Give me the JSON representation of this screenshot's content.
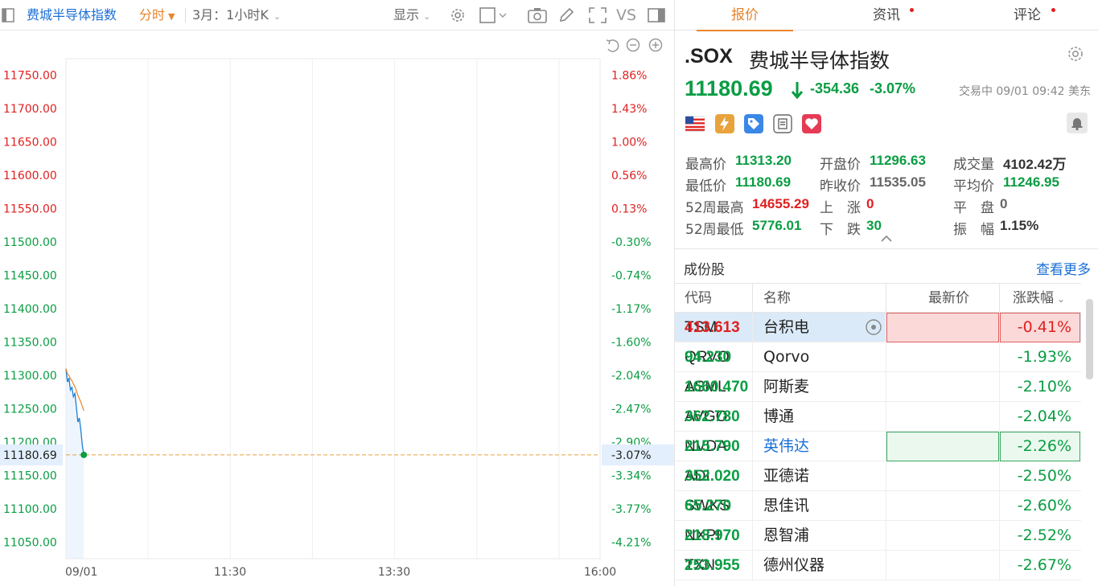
{
  "toolbar": {
    "index_name": "费城半导体指数",
    "chart_mode": "分时",
    "period": "3月：1小时K",
    "display": "显示",
    "vs": "VS"
  },
  "chart": {
    "left_axis": [
      "11750.00",
      "11700.00",
      "11650.00",
      "11600.00",
      "11550.00",
      "11500.00",
      "11450.00",
      "11400.00",
      "11350.00",
      "11300.00",
      "11250.00",
      "11200.00",
      "11150.00",
      "11100.00",
      "11050.00"
    ],
    "right_axis": [
      "1.86%",
      "1.43%",
      "1.00%",
      "0.56%",
      "0.13%",
      "-0.30%",
      "-0.74%",
      "-1.17%",
      "-1.60%",
      "-2.04%",
      "-2.47%",
      "-2.90%",
      "-3.34%",
      "-3.77%",
      "-4.21%"
    ],
    "x_labels": [
      "09/01",
      "11:30",
      "13:30",
      "16:00"
    ],
    "current_price_label": "11180.69",
    "current_pct_label": "-3.07%",
    "colors": {
      "line": "#1a7fd6",
      "avg": "#e8842c",
      "up": "#e02020",
      "down": "#0a9d43"
    }
  },
  "chart_data": {
    "type": "line",
    "x": [
      "09:30",
      "09:31",
      "09:32",
      "09:33",
      "09:34",
      "09:35",
      "09:36",
      "09:37",
      "09:38",
      "09:39",
      "09:40",
      "09:41",
      "09:42"
    ],
    "series": [
      {
        "values": [
          11310,
          11290,
          11296,
          11278,
          11282,
          11268,
          11273,
          11252,
          11230,
          11236,
          11218,
          11195,
          11180.69
        ]
      },
      {
        "values": [
          11310,
          11302,
          11300,
          11295,
          11292,
          11287,
          11283,
          11277,
          11270,
          11265,
          11260,
          11253,
          11246.95
        ]
      }
    ],
    "ylim": [
      11025,
      11775
    ],
    "xlabels": [
      "09/01",
      "11:30",
      "13:30",
      "16:00"
    ]
  },
  "tabs": [
    {
      "label": "报价"
    },
    {
      "label": "资讯"
    },
    {
      "label": "评论"
    }
  ],
  "quote": {
    "symbol": ".SOX",
    "name": "费城半导体指数",
    "price": "11180.69",
    "change": "-354.36",
    "change_pct": "-3.07%",
    "status": "交易中 09/01 09:42 美东"
  },
  "stats": {
    "high_label": "最高价",
    "high": "11313.20",
    "open_label": "开盘价",
    "open": "11296.63",
    "volume_label": "成交量",
    "volume": "4102.42万",
    "low_label": "最低价",
    "low": "11180.69",
    "prev_label": "昨收价",
    "prev": "11535.05",
    "avg_label": "平均价",
    "avg": "11246.95",
    "wk52_high_label": "52周最高",
    "wk52_high": "14655.29",
    "up_label": "上　涨",
    "up": "0",
    "flat_label": "平　盘",
    "flat": "0",
    "wk52_low_label": "52周最低",
    "wk52_low": "5776.01",
    "down_label": "下　跌",
    "down": "30",
    "amp_label": "振　幅",
    "amp": "1.15%"
  },
  "constituents": {
    "title": "成份股",
    "more": "查看更多",
    "headers": {
      "code": "代码",
      "name": "名称",
      "price": "最新价",
      "pct": "涨跌幅"
    },
    "rows": [
      {
        "code": "TSM",
        "name": "台积电",
        "price": "413.613",
        "pct": "-0.41%"
      },
      {
        "code": "QRVO",
        "name": "Qorvo",
        "price": "94.230",
        "pct": "-1.93%"
      },
      {
        "code": "ASML",
        "name": "阿斯麦",
        "price": "1660.470",
        "pct": "-2.10%"
      },
      {
        "code": "AVGO",
        "name": "博通",
        "price": "362.780",
        "pct": "-2.04%"
      },
      {
        "code": "NVDA",
        "name": "英伟达",
        "price": "215.790",
        "pct": "-2.26%"
      },
      {
        "code": "ADI",
        "name": "亚德诺",
        "price": "352.020",
        "pct": "-2.50%"
      },
      {
        "code": "SWKS",
        "name": "思佳讯",
        "price": "65.270",
        "pct": "-2.60%"
      },
      {
        "code": "NXPI",
        "name": "恩智浦",
        "price": "218.970",
        "pct": "-2.52%"
      },
      {
        "code": "TXN",
        "name": "德州仪器",
        "price": "253.955",
        "pct": "-2.67%"
      }
    ]
  }
}
